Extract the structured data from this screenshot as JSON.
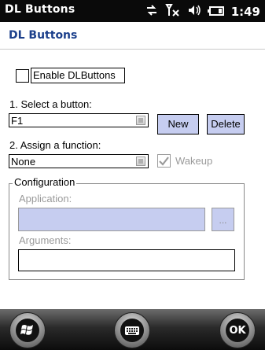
{
  "status_bar": {
    "title": "DL Buttons",
    "time": "1:49",
    "icons": [
      "data-transfer-icon",
      "no-signal-icon",
      "speaker-icon",
      "battery-icon"
    ]
  },
  "header": {
    "caption": "DL Buttons"
  },
  "enable": {
    "label": "Enable DLButtons",
    "checked": false
  },
  "select_button": {
    "label": "1. Select a button:",
    "value": "F1",
    "new_label": "New",
    "delete_label": "Delete"
  },
  "assign_function": {
    "label": "2. Assign a function:",
    "value": "None",
    "wakeup_label": "Wakeup",
    "wakeup_checked": true
  },
  "configuration": {
    "legend": "Configuration",
    "application_label": "Application:",
    "application_value": "",
    "browse_label": "...",
    "arguments_label": "Arguments:",
    "arguments_value": ""
  },
  "softkeys": {
    "ok_label": "OK",
    "start_icon": "windows-logo-icon",
    "keyboard_icon": "keyboard-icon"
  },
  "colors": {
    "header_text": "#1b3f8b",
    "button_fill": "#c6cdf0",
    "status_bar": "#0a0a0a"
  }
}
